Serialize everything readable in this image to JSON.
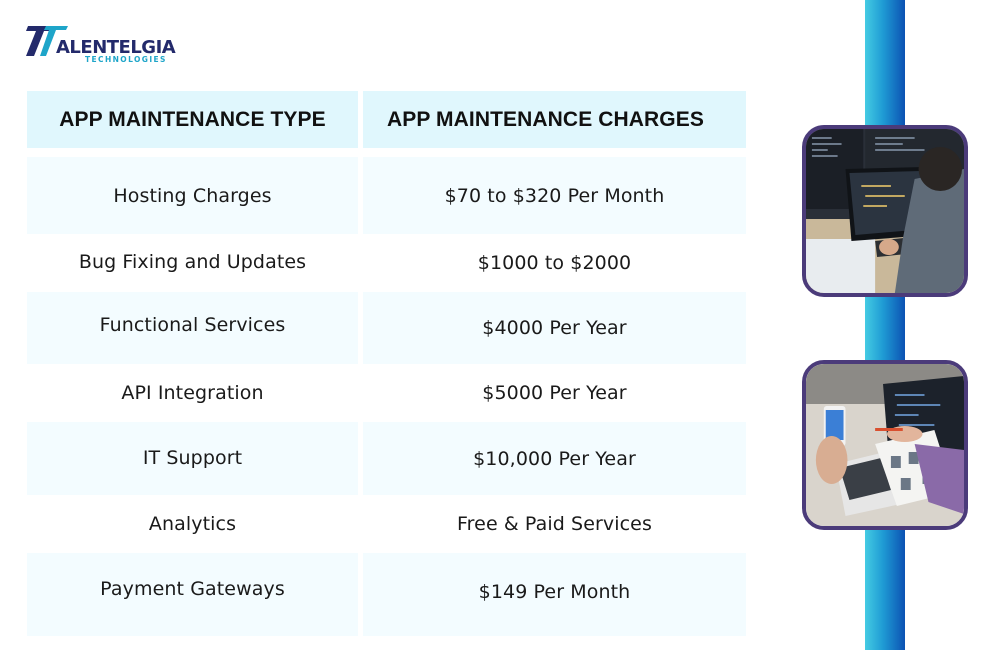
{
  "brand": {
    "name": "ALENTELGIA",
    "subtitle": "TECHNOLOGIES",
    "primary_color": "#232a6b",
    "accent_color": "#1ea5c9"
  },
  "table": {
    "headers": [
      "APP MAINTENANCE TYPE",
      "APP MAINTENANCE CHARGES"
    ],
    "rows": [
      {
        "type": "Hosting Charges",
        "charge": "$70 to $320 Per Month"
      },
      {
        "type": "Bug Fixing and Updates",
        "charge": "$1000 to $2000"
      },
      {
        "type": "Functional Services",
        "charge": "$4000 Per Year"
      },
      {
        "type": "API Integration",
        "charge": "$5000 Per Year"
      },
      {
        "type": "IT Support",
        "charge": "$10,000 Per Year"
      },
      {
        "type": "Analytics",
        "charge": "Free & Paid Services"
      },
      {
        "type": "Payment Gateways",
        "charge": "$149 Per Month"
      }
    ],
    "header_color": "#e0f7fd",
    "shade_color": "#f3fcff"
  },
  "decor": {
    "bar_gradient": [
      "#44cbe3",
      "#0c52b3"
    ],
    "frame_color": "#4b3b7a",
    "images": [
      {
        "subject": "developer-at-laptop-photo"
      },
      {
        "subject": "app-design-team-photo"
      }
    ]
  }
}
